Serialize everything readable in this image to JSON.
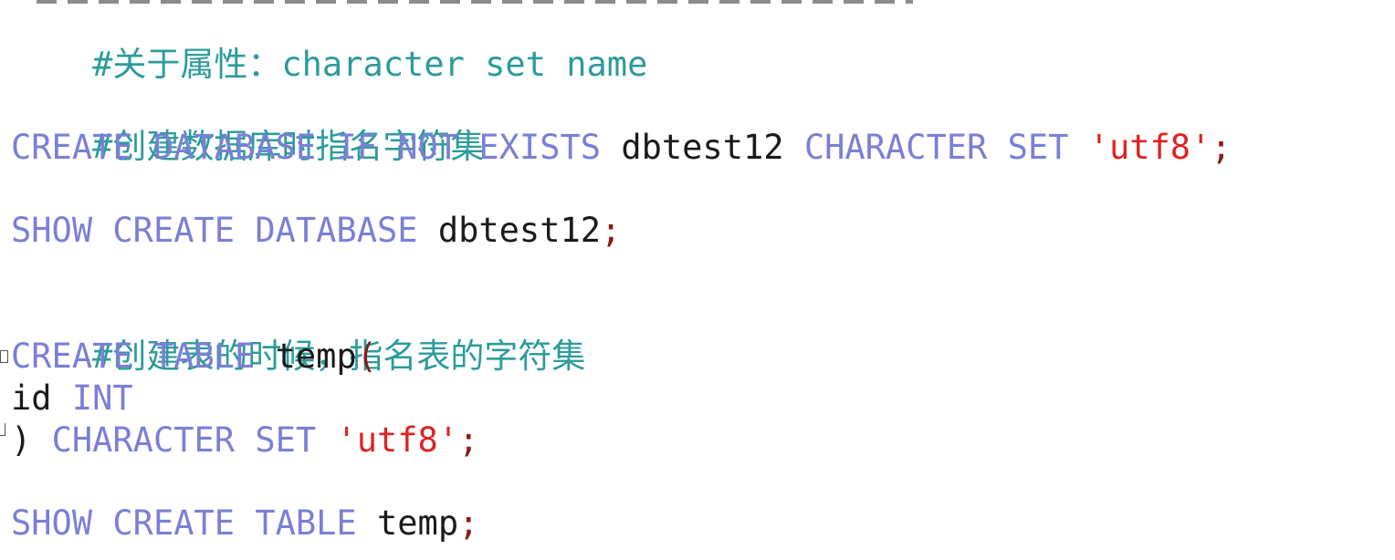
{
  "editor": {
    "lines": {
      "l1": {
        "comment": "#关于属性：character set name"
      },
      "l2": {
        "comment": "#创建数据库时指名字符集"
      },
      "l3": {
        "kw1": "CREATE",
        "kw2": "DATABASE",
        "kw3": "IF",
        "kw4": "NOT",
        "kw5": "EXISTS",
        "ident": "dbtest12",
        "kw6": "CHARACTER",
        "kw7": "SET",
        "str": "'utf8'",
        "semi": ";"
      },
      "l4": {
        "kw1": "SHOW",
        "kw2": "CREATE",
        "kw3": "DATABASE",
        "ident": "dbtest12",
        "semi": ";"
      },
      "l5": {
        "comment": "#创建表的时候，指名表的字符集"
      },
      "l6": {
        "kw1": "CREATE",
        "kw2": "TABLE",
        "ident": "temp",
        "paren": "("
      },
      "l7": {
        "ident": "id",
        "kw1": "INT"
      },
      "l8": {
        "paren": ")",
        "kw1": "CHARACTER",
        "kw2": "SET",
        "str": "'utf8'",
        "semi": ";"
      },
      "l9": {
        "kw1": "SHOW",
        "kw2": "CREATE",
        "kw3": "TABLE",
        "ident": "temp",
        "semi": ";"
      }
    }
  }
}
